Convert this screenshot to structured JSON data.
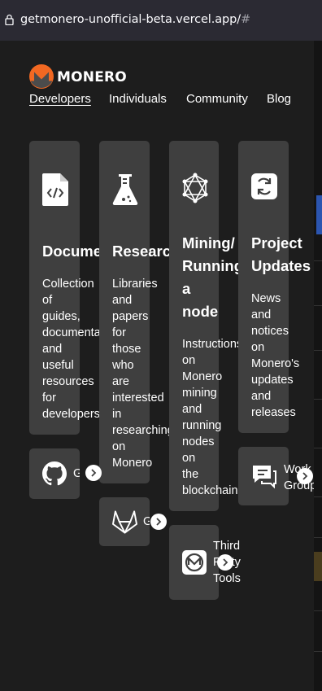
{
  "browser": {
    "url_main": "getmonero-unofficial-beta.vercel.app/",
    "url_hash": "#"
  },
  "brand": {
    "logo_text": "MONERO"
  },
  "nav": [
    {
      "label": "Developers",
      "active": true
    },
    {
      "label": "Individuals"
    },
    {
      "label": "Community"
    },
    {
      "label": "Blog"
    }
  ],
  "cards": [
    {
      "title": [
        "Documentation"
      ],
      "desc": [
        "Collection",
        "of",
        "guides,",
        "documentation",
        "and",
        "useful",
        "resources",
        "for",
        "developers"
      ],
      "icon": "code-file-icon"
    },
    {
      "title": [
        "Research"
      ],
      "desc": [
        "Libraries",
        "and",
        "papers",
        "for",
        "those",
        "who",
        "are",
        "interested",
        "in",
        "researching",
        "on",
        "Monero"
      ],
      "icon": "flask-icon"
    },
    {
      "title": [
        "Mining/",
        "Running",
        "a",
        "node"
      ],
      "desc": [
        "Instructions",
        "on",
        "Monero",
        "mining",
        "and",
        "running",
        "nodes",
        "on",
        "the",
        "blockchain"
      ],
      "icon": "network-icon"
    },
    {
      "title": [
        "Project",
        "Updates"
      ],
      "desc": [
        "News",
        "and",
        "notices",
        "on",
        "Monero's",
        "updates",
        "and",
        "releases"
      ],
      "icon": "refresh-icon"
    }
  ],
  "links": [
    {
      "label": [
        "GitHub"
      ],
      "icon": "github-icon"
    },
    {
      "label": [
        "GitLab"
      ],
      "icon": "gitlab-icon"
    },
    {
      "label": [
        "Third",
        "Party",
        "Tools"
      ],
      "icon": "monero-icon"
    },
    {
      "label": [
        "Work",
        "Groups"
      ],
      "icon": "chat-icon"
    }
  ],
  "colors": {
    "accent": "#f26822",
    "card": "#3f3f3f",
    "background": "#1d1d1d"
  }
}
